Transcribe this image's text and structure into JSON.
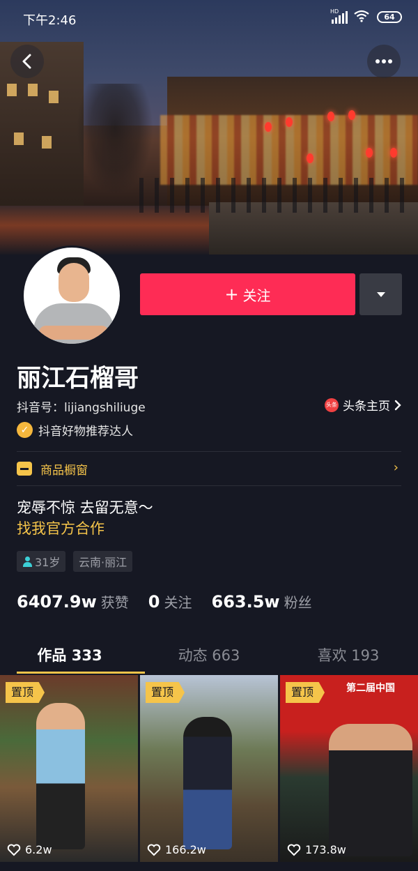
{
  "status_bar": {
    "time": "下午2:46",
    "network": "HD",
    "battery": "64"
  },
  "profile": {
    "follow_label": "关注",
    "follow_plus": "+",
    "name": "丽江石榴哥",
    "douyin_id": "抖音号：lijiangshiliuge",
    "toutiao_icon": "头条",
    "toutiao_label": "头条主页",
    "verify_label": "抖音好物推荐达人",
    "shop_label": "商品橱窗",
    "bio_line1": "宠辱不惊 去留无意～",
    "bio_line2": "找我官方合作",
    "tags": {
      "age": "31岁",
      "location": "云南·丽江"
    }
  },
  "stats": {
    "likes_value": "6407.9w",
    "likes_label": "获赞",
    "following_value": "0",
    "following_label": "关注",
    "fans_value": "663.5w",
    "fans_label": "粉丝"
  },
  "tabs": [
    {
      "label": "作品 333"
    },
    {
      "label": "动态 663"
    },
    {
      "label": "喜欢 193"
    }
  ],
  "videos": [
    {
      "pin": "置顶",
      "likes": "6.2w"
    },
    {
      "pin": "置顶",
      "likes": "166.2w"
    },
    {
      "pin": "置顶",
      "likes": "173.8w",
      "banner": "第二届中国"
    }
  ],
  "colors": {
    "accent": "#fe2c55",
    "gold": "#f5c44a",
    "bg": "#161823"
  },
  "icons": [
    "back-icon",
    "more-icon",
    "dropdown-icon",
    "verified-icon",
    "shop-icon",
    "chevron-right-icon",
    "person-icon",
    "heart-icon",
    "toutiao-icon"
  ]
}
